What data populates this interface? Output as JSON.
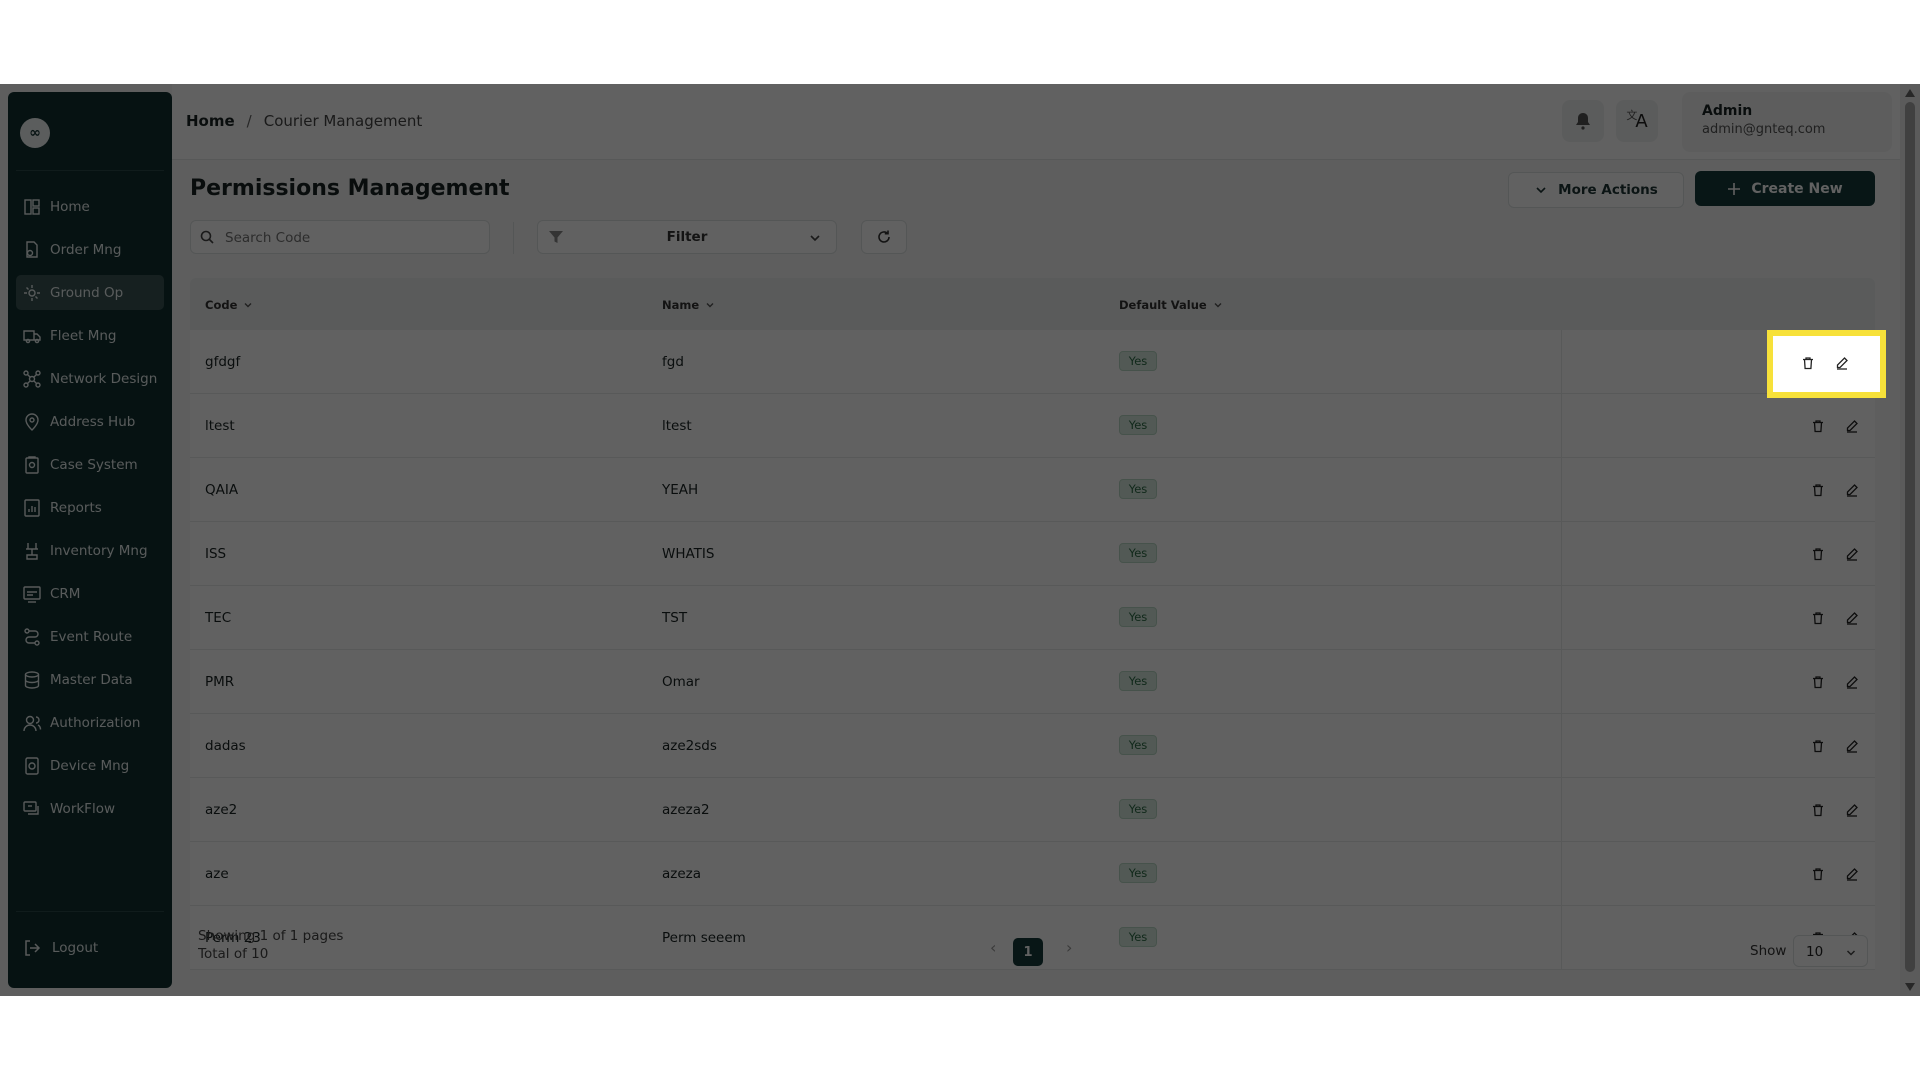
{
  "sidebar": {
    "logo_text": "∞",
    "items": [
      {
        "label": "Home",
        "icon": "home-icon"
      },
      {
        "label": "Order Mng",
        "icon": "order-icon"
      },
      {
        "label": "Ground Op",
        "icon": "ground-op-icon",
        "active": true
      },
      {
        "label": "Fleet Mng",
        "icon": "truck-icon"
      },
      {
        "label": "Network Design",
        "icon": "network-icon"
      },
      {
        "label": "Address Hub",
        "icon": "location-icon"
      },
      {
        "label": "Case System",
        "icon": "case-icon"
      },
      {
        "label": "Reports",
        "icon": "reports-icon"
      },
      {
        "label": "Inventory Mng",
        "icon": "inventory-icon"
      },
      {
        "label": "CRM",
        "icon": "crm-icon"
      },
      {
        "label": "Event Route",
        "icon": "route-icon"
      },
      {
        "label": "Master Data",
        "icon": "database-icon"
      },
      {
        "label": "Authorization",
        "icon": "users-icon"
      },
      {
        "label": "Device Mng",
        "icon": "device-icon"
      },
      {
        "label": "WorkFlow",
        "icon": "workflow-icon"
      }
    ],
    "logout_label": "Logout"
  },
  "header": {
    "breadcrumb": [
      "Home",
      "Courier Management"
    ],
    "breadcrumb_sep": "/",
    "user_name": "Admin",
    "user_email": "admin@gnteq.com",
    "lang_label": "A"
  },
  "page": {
    "title": "Permissions Management",
    "more_actions_label": "More Actions",
    "create_label": "Create New",
    "search_placeholder": "Search Code",
    "filter_label": "Filter"
  },
  "table": {
    "columns": [
      "Code",
      "Name",
      "Default Value"
    ],
    "rows": [
      {
        "code": "gfdgf",
        "name": "fgd",
        "default": "Yes"
      },
      {
        "code": "ltest",
        "name": "ltest",
        "default": "Yes"
      },
      {
        "code": "QAIA",
        "name": "YEAH",
        "default": "Yes"
      },
      {
        "code": "ISS",
        "name": "WHATIS",
        "default": "Yes"
      },
      {
        "code": "TEC",
        "name": "TST",
        "default": "Yes"
      },
      {
        "code": "PMR",
        "name": "Omar",
        "default": "Yes"
      },
      {
        "code": "dadas",
        "name": "aze2sds",
        "default": "Yes"
      },
      {
        "code": "aze2",
        "name": "azeza2",
        "default": "Yes"
      },
      {
        "code": "aze",
        "name": "azeza",
        "default": "Yes"
      },
      {
        "code": "Perm 23",
        "name": "Perm seeem",
        "default": "Yes"
      }
    ]
  },
  "footer": {
    "showing": "Showing 1 of 1 pages",
    "total": "Total of 10",
    "current_page": "1",
    "show_label": "Show",
    "page_size": "10"
  },
  "colors": {
    "sidebar_bg": "#123131",
    "primary": "#163b3b",
    "badge_bg": "#d8ebdf",
    "highlight": "#f7e13a"
  }
}
